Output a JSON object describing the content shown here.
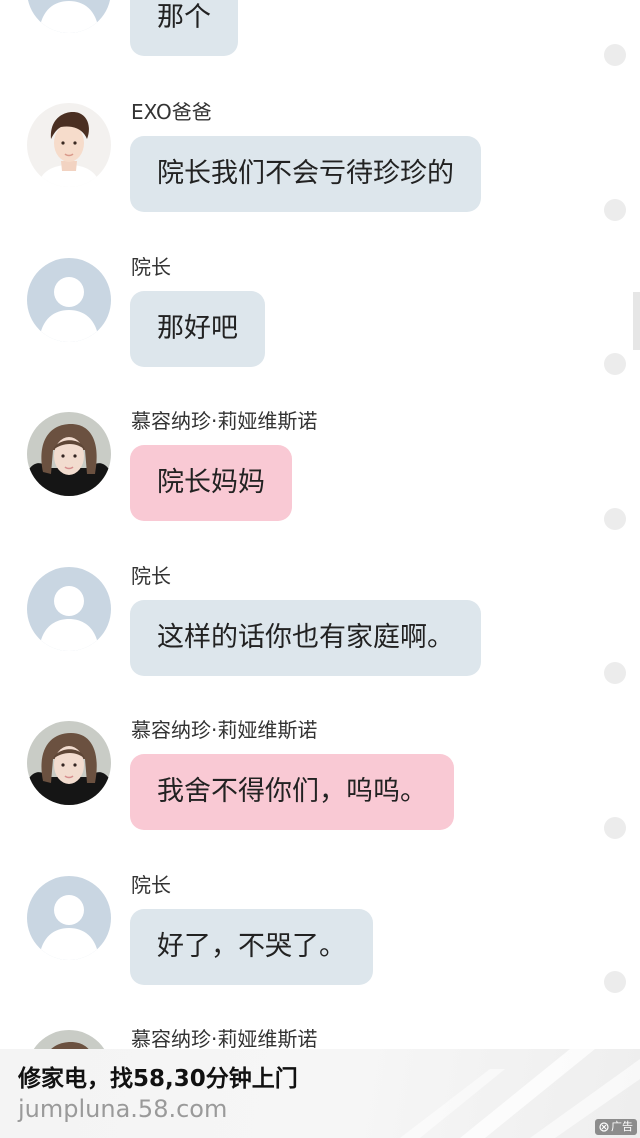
{
  "messages": [
    {
      "sender": "",
      "avatar": "default-avatar",
      "text": "那个",
      "bubble_color": "#dde6ec"
    },
    {
      "sender": "EXO爸爸",
      "avatar": "boy-photo-avatar",
      "text": "院长我们不会亏待珍珍的",
      "bubble_color": "#dde6ec"
    },
    {
      "sender": "院长",
      "avatar": "default-avatar",
      "text": "那好吧",
      "bubble_color": "#dde6ec"
    },
    {
      "sender": "慕容纳珍·莉娅维斯诺",
      "avatar": "girl-photo-avatar",
      "text": "院长妈妈",
      "bubble_color": "#f9c9d4"
    },
    {
      "sender": "院长",
      "avatar": "default-avatar",
      "text": "这样的话你也有家庭啊。",
      "bubble_color": "#dde6ec"
    },
    {
      "sender": "慕容纳珍·莉娅维斯诺",
      "avatar": "girl-photo-avatar",
      "text": "我舍不得你们，呜呜。",
      "bubble_color": "#f9c9d4"
    },
    {
      "sender": "院长",
      "avatar": "default-avatar",
      "text": "好了，不哭了。",
      "bubble_color": "#dde6ec"
    },
    {
      "sender": "慕容纳珍·莉娅维斯诺",
      "avatar": "girl-photo-avatar",
      "text": "",
      "bubble_color": "#f9c9d4"
    }
  ],
  "ad": {
    "title": "修家电，找58,30分钟上门",
    "domain": "jumpluna.58.com",
    "badge_label": "广告",
    "badge_icon": "ad-close-icon"
  },
  "colors": {
    "gray_bubble": "#dde6ec",
    "pink_bubble": "#f9c9d4",
    "default_avatar_bg": "#c9d6e2"
  }
}
